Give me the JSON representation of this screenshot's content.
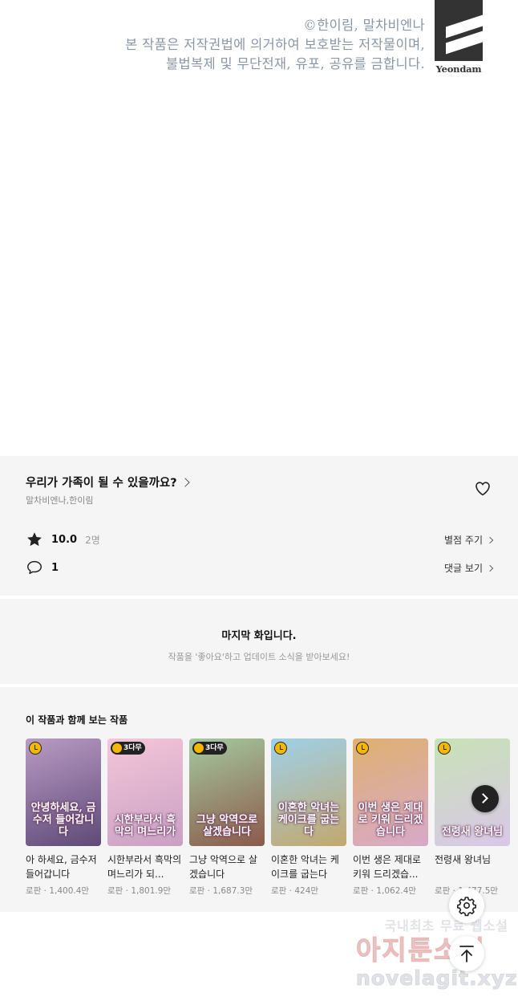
{
  "copyright": {
    "line1": "©한이림, 말차비엔나",
    "line2": "본 작품은 저작권법에 의거하여 보호받는 저작물이며,",
    "line3": "불법복제 및 무단전재, 유포, 공유를 금합니다.",
    "publisher": "Yeondam"
  },
  "series": {
    "title": "우리가 가족이 될 수 있을까요?",
    "authors": "말차비엔나,한이림",
    "rating": "10.0",
    "rating_count": "2명",
    "rate_link": "별점 주기",
    "comment_count": "1",
    "comment_link": "댓글 보기"
  },
  "last_episode": {
    "title": "마지막 화입니다.",
    "subtitle": "작품을 '좋아요'하고 업데이트 소식을 받아보세요!"
  },
  "recommendations": {
    "heading": "이 작품과 함께 보는 작품",
    "items": [
      {
        "name": "아 하세요, 금수저 들어갑니다",
        "meta": "로판 · 1,400.4만",
        "badge": "clock",
        "badge_text": "",
        "cover_text": "안녕하세요, 금수저 들어갑니다",
        "color_top": "#b99bc4",
        "color_bottom": "#5e4a78"
      },
      {
        "name": "시한부라서 흑막의 며느리가 되...",
        "meta": "로판 · 1,801.9만",
        "badge": "3free",
        "badge_text": "3다무",
        "cover_text": "시한부라서 흑막의 며느리가",
        "color_top": "#f4c6d8",
        "color_bottom": "#c9a0c4"
      },
      {
        "name": "그냥 악역으로 살겠습니다",
        "meta": "로판 · 1,687.3만",
        "badge": "3free",
        "badge_text": "3다무",
        "cover_text": "그냥 악역으로 살겠습니다",
        "color_top": "#a4c9a0",
        "color_bottom": "#8b5a4a"
      },
      {
        "name": "이혼한 악녀는 케이크를 굽는다",
        "meta": "로판 · 424만",
        "badge": "clock",
        "badge_text": "",
        "cover_text": "이혼한 악녀는 케이크를 굽는다",
        "color_top": "#9fd0e8",
        "color_bottom": "#c2a86e"
      },
      {
        "name": "이번 생은 제대로 키워 드리겠습...",
        "meta": "로판 · 1,062.4만",
        "badge": "clock",
        "badge_text": "",
        "cover_text": "이번 생은 제대로 키워 드리겠습니다",
        "color_top": "#e0b070",
        "color_bottom": "#d7a9c9"
      },
      {
        "name": "전령새 왕녀님",
        "meta": "로판 · 1,477.5만",
        "badge": "clock",
        "badge_text": "",
        "cover_text": "전령새 왕녀님",
        "color_top": "#c8e2b6",
        "color_bottom": "#d9c7e8"
      }
    ]
  },
  "watermark": {
    "line1": "국내최초 무료 웹소설",
    "line2": "아지툰소설",
    "line3": "novelagit.xyz"
  },
  "icons": {
    "heart": "heart-outline-icon",
    "star": "star-icon",
    "comment": "comment-icon",
    "next": "chevron-right-icon",
    "settings": "gear-icon",
    "top": "arrow-up-icon"
  }
}
